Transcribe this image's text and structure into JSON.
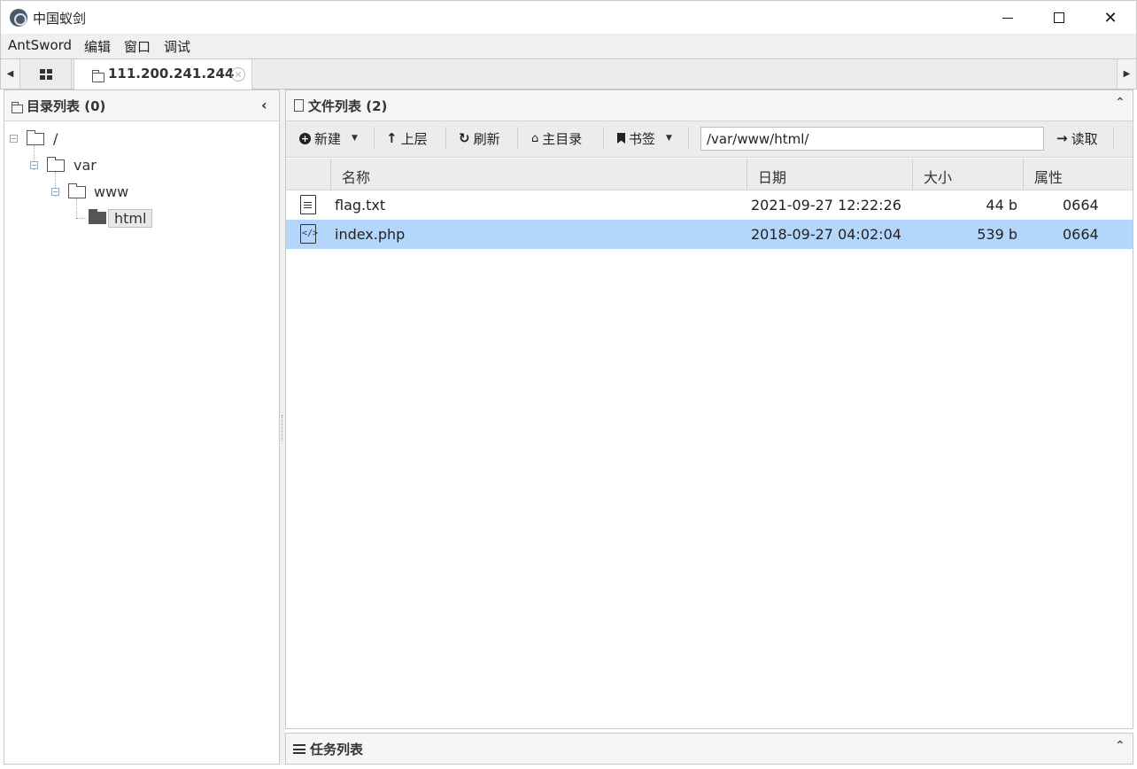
{
  "window": {
    "title": "中国蚁剑",
    "minimize_glyph": "—",
    "maximize_glyph": "☐",
    "close_glyph": "✕"
  },
  "menu": {
    "items": [
      "AntSword",
      "编辑",
      "窗口",
      "调试"
    ]
  },
  "tabs": {
    "host": "111.200.241.244"
  },
  "left_panel": {
    "title": "目录列表 (0)",
    "tree": [
      {
        "label": "/",
        "depth": 0,
        "expanded": true
      },
      {
        "label": "var",
        "depth": 1,
        "expanded": true
      },
      {
        "label": "www",
        "depth": 2,
        "expanded": true
      },
      {
        "label": "html",
        "depth": 3,
        "selected": true
      }
    ]
  },
  "right_panel": {
    "title": "文件列表 (2)",
    "toolbar": {
      "new_label": "新建",
      "up_label": "上层",
      "refresh_label": "刷新",
      "home_label": "主目录",
      "bookmark_label": "书签",
      "read_label": "读取"
    },
    "path": "/var/www/html/",
    "columns": {
      "name": "名称",
      "date": "日期",
      "size": "大小",
      "attr": "属性"
    },
    "files": [
      {
        "name": "flag.txt",
        "date": "2021-09-27 12:22:26",
        "size": "44 b",
        "attr": "0664",
        "icon": "text-file-icon",
        "selected": false
      },
      {
        "name": "index.php",
        "date": "2018-09-27 04:02:04",
        "size": "539 b",
        "attr": "0664",
        "icon": "code-file-icon",
        "selected": true
      }
    ]
  },
  "task_panel": {
    "title": "任务列表"
  },
  "colors": {
    "selection": "#b5d6fb",
    "header_bg": "#f5f5f5",
    "toolbar_bg": "#ececec"
  }
}
